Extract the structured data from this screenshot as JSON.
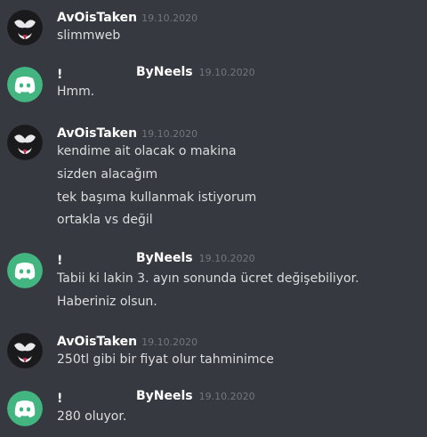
{
  "colors": {
    "background": "#36393f",
    "discord_green": "#43b581",
    "username": "#ffffff",
    "timestamp": "#72767d",
    "message_text": "#dcddde"
  },
  "messages": [
    {
      "author": "AvOisTaken",
      "avatar_icon": "venom-avatar-icon",
      "timestamp": "19.10.2020",
      "lines": [
        "slimmweb"
      ]
    },
    {
      "author_prefix": "!",
      "author": "ByNeels",
      "avatar_icon": "discord-logo-icon",
      "timestamp": "19.10.2020",
      "lines": [
        "Hmm."
      ]
    },
    {
      "author": "AvOisTaken",
      "avatar_icon": "venom-avatar-icon",
      "timestamp": "19.10.2020",
      "lines": [
        "kendime ait olacak o makina",
        "sizden alacağım",
        "tek başıma kullanmak istiyorum",
        "ortakla vs değil"
      ]
    },
    {
      "author_prefix": "!",
      "author": "ByNeels",
      "avatar_icon": "discord-logo-icon",
      "timestamp": "19.10.2020",
      "lines": [
        "Tabii ki lakin 3. ayın sonunda ücret değişebiliyor.",
        "Haberiniz olsun."
      ]
    },
    {
      "author": "AvOisTaken",
      "avatar_icon": "venom-avatar-icon",
      "timestamp": "19.10.2020",
      "lines": [
        "250tl gibi bir fiyat olur tahminimce"
      ]
    },
    {
      "author_prefix": "!",
      "author": "ByNeels",
      "avatar_icon": "discord-logo-icon",
      "timestamp": "19.10.2020",
      "lines": [
        "280 oluyor."
      ]
    }
  ]
}
